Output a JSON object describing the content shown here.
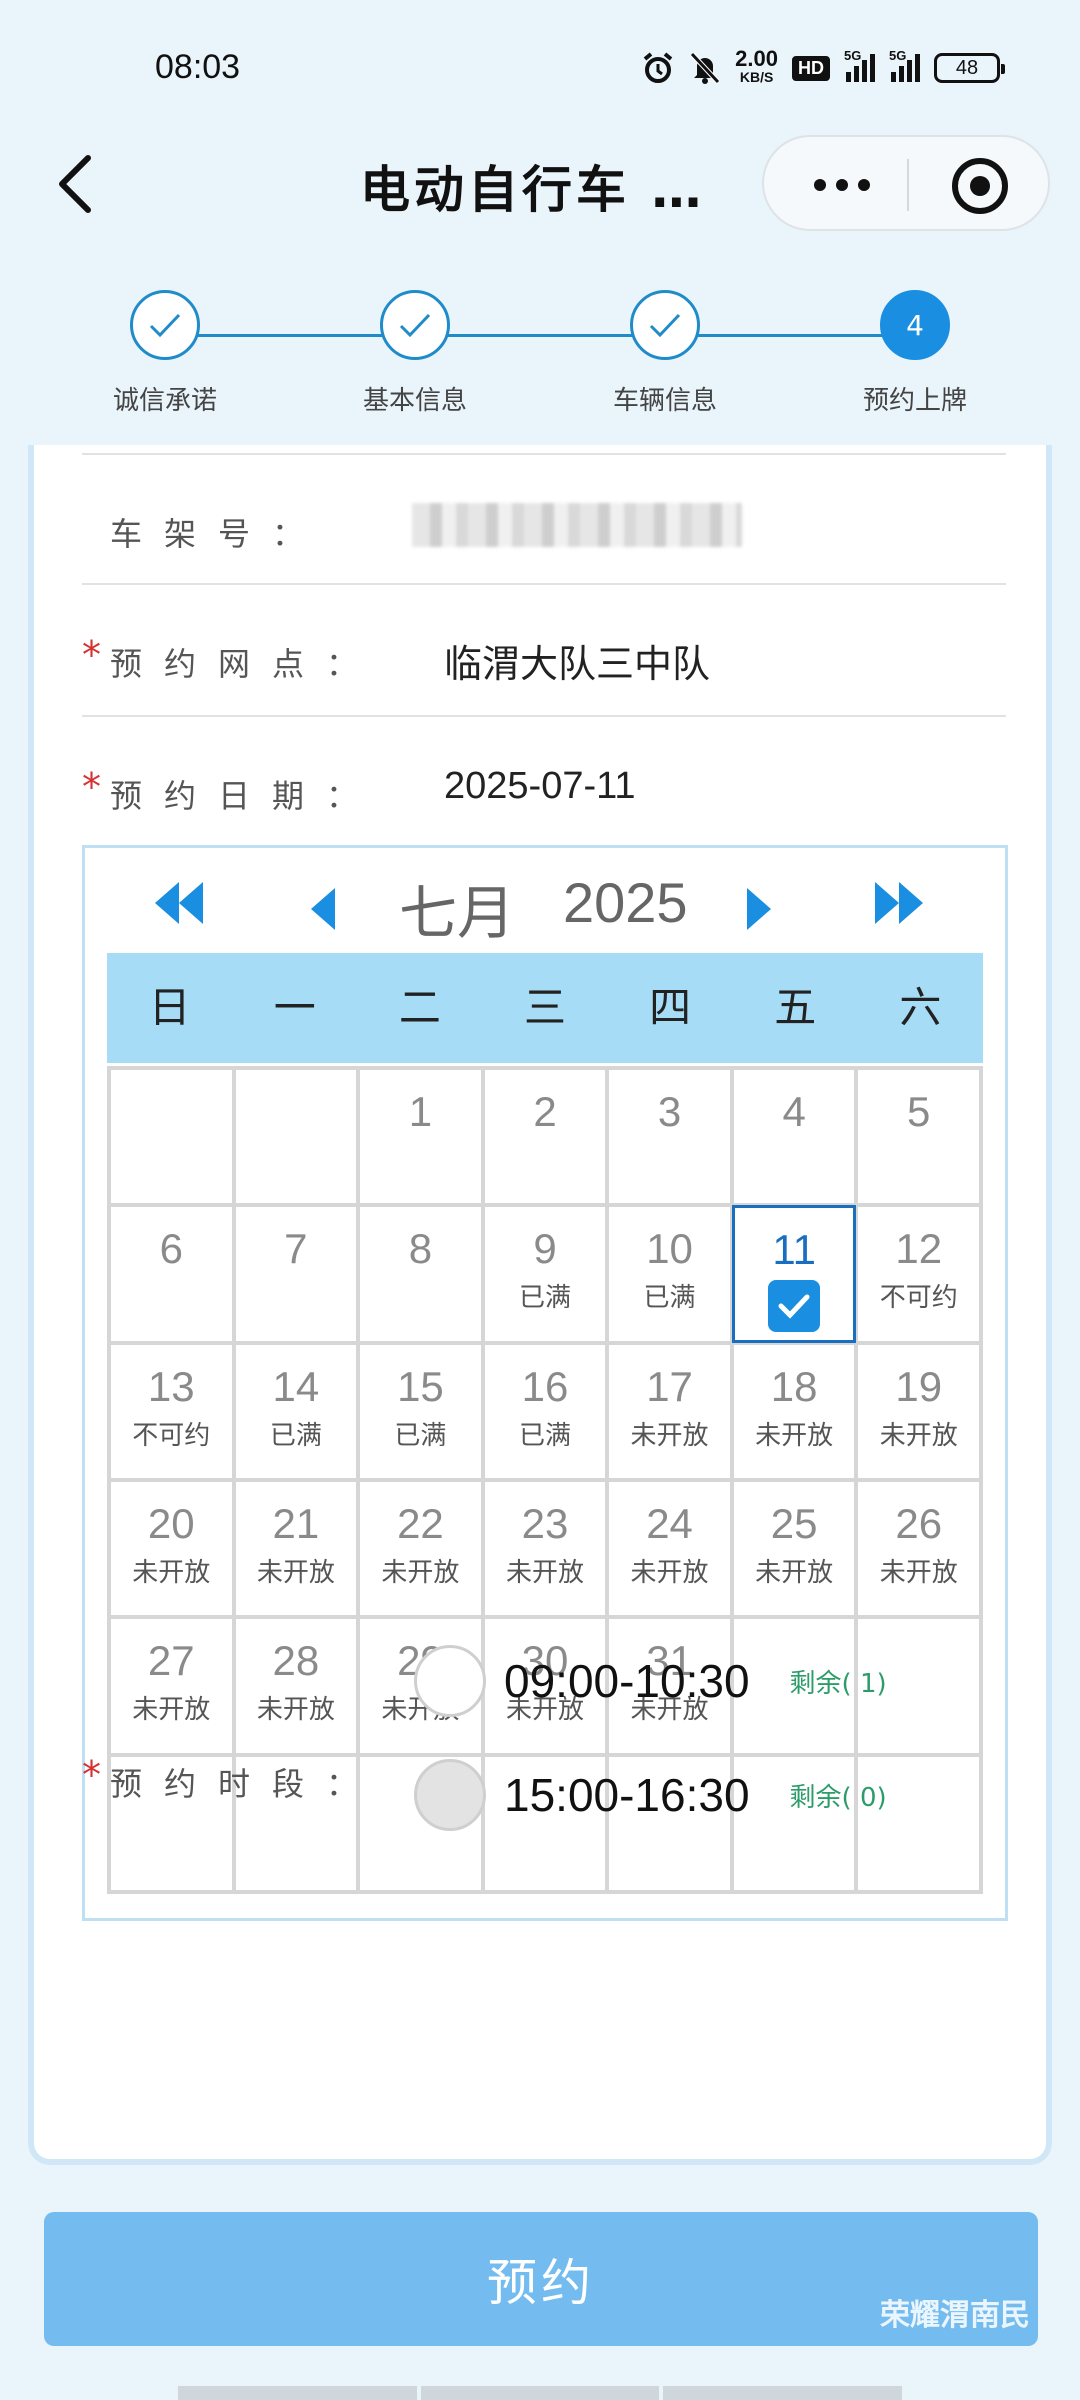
{
  "status_bar": {
    "time": "08:03",
    "speed_value": "2.00",
    "speed_unit": "KB/S",
    "hd": "HD",
    "sig1": "5G",
    "sig2": "5G",
    "battery": "48"
  },
  "nav": {
    "title": "电动自行车 …"
  },
  "steps": [
    {
      "label": "诚信承诺",
      "state": "done"
    },
    {
      "label": "基本信息",
      "state": "done"
    },
    {
      "label": "车辆信息",
      "state": "done"
    },
    {
      "label": "预约上牌",
      "state": "active",
      "number": "4"
    }
  ],
  "form": {
    "frame_label": "车架号：",
    "outlet_label": "预约网点：",
    "outlet_value": "临渭大队三中队",
    "date_label": "预约日期：",
    "date_value": "2025-07-11",
    "slot_label": "预约时段：",
    "required_mark": "*"
  },
  "calendar": {
    "month": "七月",
    "year": "2025",
    "weekdays": [
      "日",
      "一",
      "二",
      "三",
      "四",
      "五",
      "六"
    ],
    "days": [
      {
        "d": "",
        "s": ""
      },
      {
        "d": "",
        "s": ""
      },
      {
        "d": "1",
        "s": ""
      },
      {
        "d": "2",
        "s": ""
      },
      {
        "d": "3",
        "s": ""
      },
      {
        "d": "4",
        "s": ""
      },
      {
        "d": "5",
        "s": ""
      },
      {
        "d": "6",
        "s": ""
      },
      {
        "d": "7",
        "s": ""
      },
      {
        "d": "8",
        "s": ""
      },
      {
        "d": "9",
        "s": "已满"
      },
      {
        "d": "10",
        "s": "已满"
      },
      {
        "d": "11",
        "s": "",
        "selected": true
      },
      {
        "d": "12",
        "s": "不可约"
      },
      {
        "d": "13",
        "s": "不可约"
      },
      {
        "d": "14",
        "s": "已满"
      },
      {
        "d": "15",
        "s": "已满"
      },
      {
        "d": "16",
        "s": "已满"
      },
      {
        "d": "17",
        "s": "未开放"
      },
      {
        "d": "18",
        "s": "未开放"
      },
      {
        "d": "19",
        "s": "未开放"
      },
      {
        "d": "20",
        "s": "未开放"
      },
      {
        "d": "21",
        "s": "未开放"
      },
      {
        "d": "22",
        "s": "未开放"
      },
      {
        "d": "23",
        "s": "未开放"
      },
      {
        "d": "24",
        "s": "未开放"
      },
      {
        "d": "25",
        "s": "未开放"
      },
      {
        "d": "26",
        "s": "未开放"
      },
      {
        "d": "27",
        "s": "未开放"
      },
      {
        "d": "28",
        "s": "未开放"
      },
      {
        "d": "29",
        "s": "未开放"
      },
      {
        "d": "30",
        "s": "未开放"
      },
      {
        "d": "31",
        "s": "未开放"
      },
      {
        "d": "",
        "s": ""
      },
      {
        "d": "",
        "s": ""
      },
      {
        "d": "",
        "s": ""
      },
      {
        "d": "",
        "s": ""
      },
      {
        "d": "",
        "s": ""
      },
      {
        "d": "",
        "s": ""
      },
      {
        "d": "",
        "s": ""
      },
      {
        "d": "",
        "s": ""
      },
      {
        "d": "",
        "s": ""
      }
    ]
  },
  "slots": [
    {
      "time": "09:00-10:30",
      "remain": "剩余( 1)",
      "disabled": false
    },
    {
      "time": "15:00-16:30",
      "remain": "剩余( 0)",
      "disabled": true
    }
  ],
  "submit_label": "预约",
  "watermark": "荣耀渭南民",
  "colors": {
    "accent": "#1a8ee0",
    "weekday_bg": "#a7dcf6",
    "submit_bg": "#74bcef",
    "remain": "#2e9c6a",
    "required": "#d63131"
  }
}
